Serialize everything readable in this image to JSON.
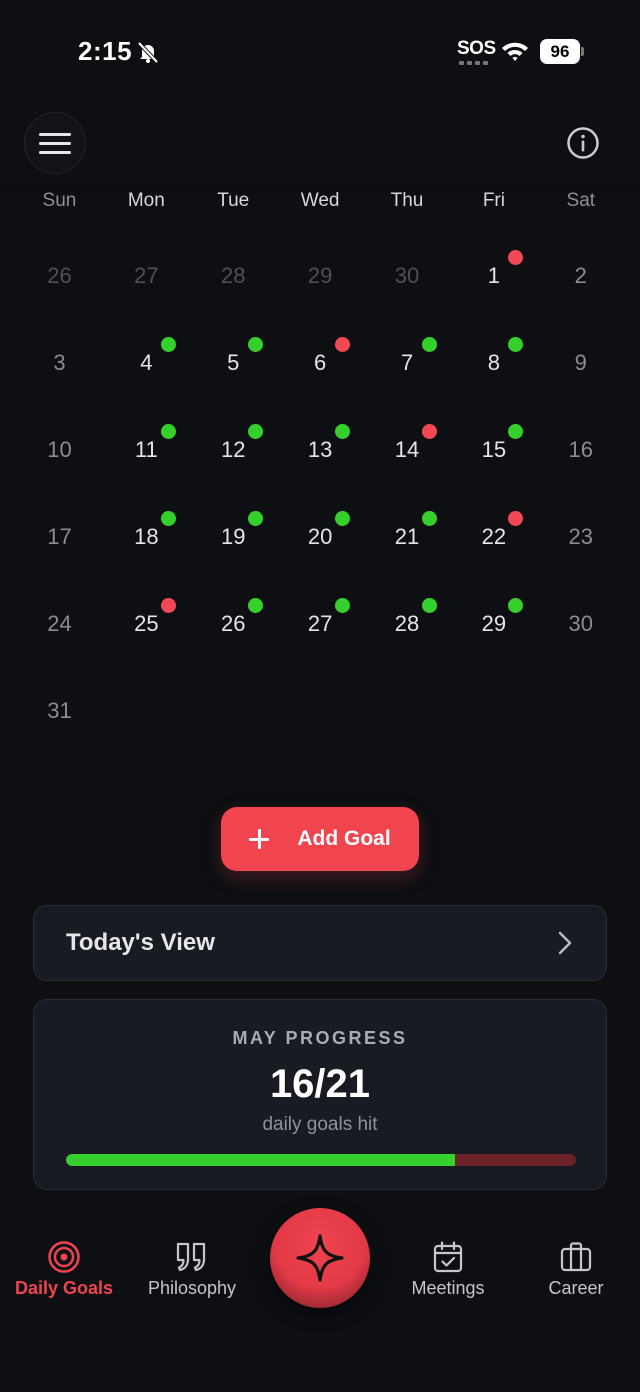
{
  "status_bar": {
    "time": "2:15",
    "sos": "SOS",
    "battery": "96"
  },
  "calendar": {
    "weekdays": [
      "Sun",
      "Mon",
      "Tue",
      "Wed",
      "Thu",
      "Fri",
      "Sat"
    ],
    "days": [
      {
        "n": "26",
        "muted": true
      },
      {
        "n": "27",
        "muted": true
      },
      {
        "n": "28",
        "muted": true
      },
      {
        "n": "29",
        "muted": true
      },
      {
        "n": "30",
        "muted": true
      },
      {
        "n": "1",
        "dot": "red"
      },
      {
        "n": "2"
      },
      {
        "n": "3"
      },
      {
        "n": "4",
        "dot": "green"
      },
      {
        "n": "5",
        "dot": "green"
      },
      {
        "n": "6",
        "dot": "red"
      },
      {
        "n": "7",
        "dot": "green"
      },
      {
        "n": "8",
        "dot": "green"
      },
      {
        "n": "9"
      },
      {
        "n": "10"
      },
      {
        "n": "11",
        "dot": "green"
      },
      {
        "n": "12",
        "dot": "green"
      },
      {
        "n": "13",
        "dot": "green"
      },
      {
        "n": "14",
        "dot": "red"
      },
      {
        "n": "15",
        "dot": "green"
      },
      {
        "n": "16"
      },
      {
        "n": "17"
      },
      {
        "n": "18",
        "dot": "green"
      },
      {
        "n": "19",
        "dot": "green"
      },
      {
        "n": "20",
        "dot": "green"
      },
      {
        "n": "21",
        "dot": "green"
      },
      {
        "n": "22",
        "dot": "red"
      },
      {
        "n": "23"
      },
      {
        "n": "24"
      },
      {
        "n": "25",
        "dot": "red"
      },
      {
        "n": "26",
        "dot": "green"
      },
      {
        "n": "27",
        "dot": "green"
      },
      {
        "n": "28",
        "dot": "green"
      },
      {
        "n": "29",
        "dot": "green"
      },
      {
        "n": "30"
      },
      {
        "n": "31"
      }
    ]
  },
  "add_goal": {
    "label": "Add Goal"
  },
  "todays_view": {
    "label": "Today's View"
  },
  "progress": {
    "title": "MAY PROGRESS",
    "value": "16/21",
    "caption": "daily goals hit",
    "fraction": 0.762
  },
  "nav": {
    "items": [
      {
        "key": "daily-goals",
        "label": "Daily Goals",
        "active": true
      },
      {
        "key": "philosophy",
        "label": "Philosophy"
      },
      {
        "key": "meetings",
        "label": "Meetings"
      },
      {
        "key": "career",
        "label": "Career"
      }
    ]
  },
  "colors": {
    "accent": "#f0444f",
    "success": "#35d02b",
    "miss": "#f24856",
    "background": "#0d0f13",
    "card": "#181b22"
  }
}
